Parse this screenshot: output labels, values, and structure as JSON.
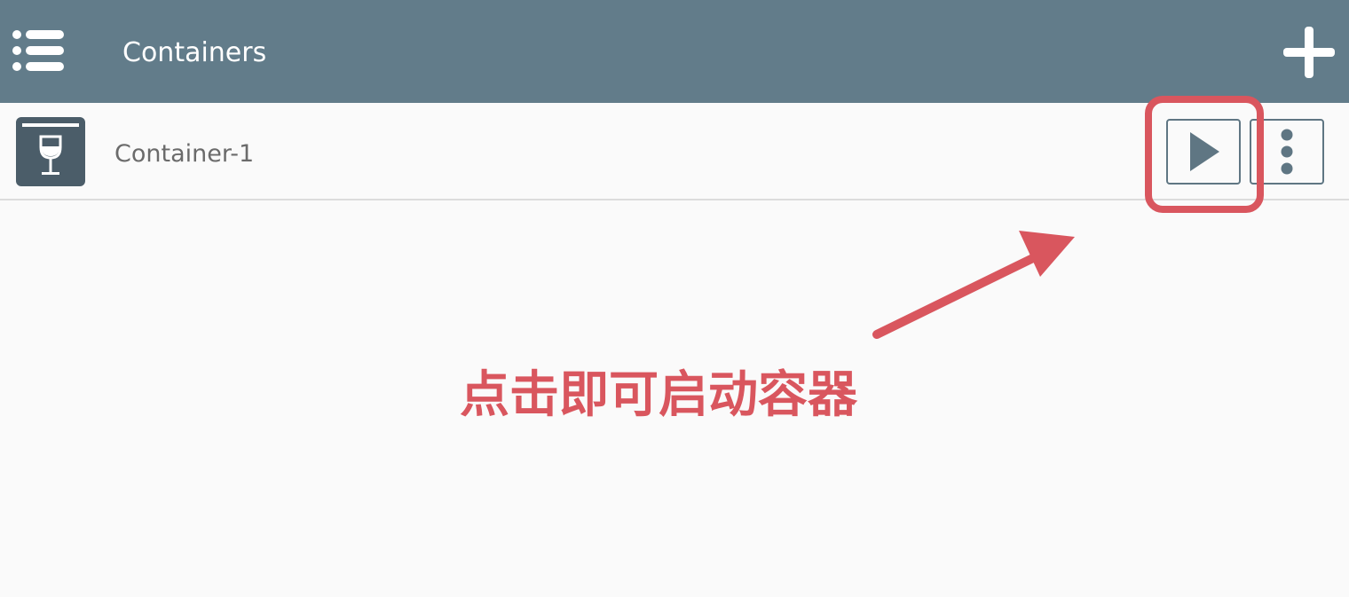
{
  "app_bar": {
    "title": "Containers",
    "menu_icon": "menu-list-icon",
    "add_icon": "plus-icon",
    "background_color": "#627c8a"
  },
  "containers": [
    {
      "name": "Container-1",
      "icon": "wine-glass-icon",
      "run_icon": "play-icon",
      "more_icon": "more-vertical-icon"
    }
  ],
  "annotation": {
    "text": "点击即可启动容器",
    "color": "#d9565e"
  }
}
